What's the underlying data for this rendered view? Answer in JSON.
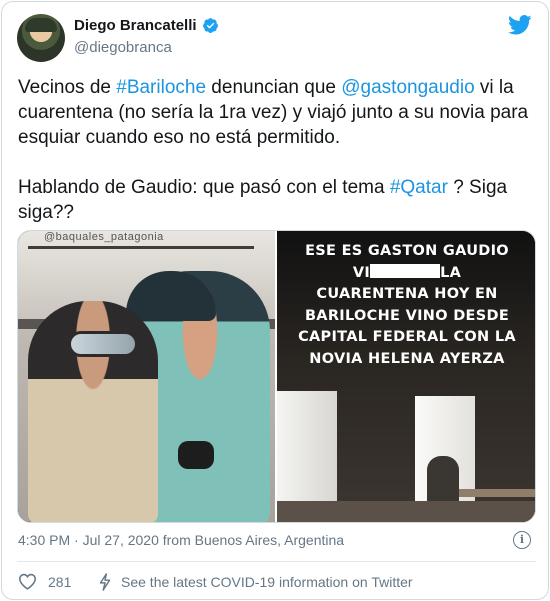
{
  "author": {
    "display_name": "Diego Brancatelli",
    "handle": "@diegobranca",
    "verified": true
  },
  "tweet": {
    "line1_a": "Vecinos de ",
    "hashtag1": "#Bariloche",
    "line1_b": " denuncian que ",
    "mention": "@gastongaudio",
    "line1_c": " vi la cuarentena (no sería la 1ra vez) y viajó junto a su novia para esquiar cuando eso no está permitido.",
    "line2_a": "Hablando de Gaudio: que pasó con el tema ",
    "hashtag2": "#Qatar",
    "line2_b": " ? Siga siga??"
  },
  "media": {
    "left_photo_tag": "@baquales_patagonia",
    "caption_line1": "ESE ES GASTON GAUDIO",
    "caption_line2_a": "VI",
    "caption_line2_b": "LA",
    "caption_rest": "CUARENTENA HOY EN BARILOCHE VINO DESDE CAPITAL FEDERAL CON LA NOVIA HELENA AYERZA"
  },
  "meta": {
    "timestamp": "4:30 PM · Jul 27, 2020 from Buenos Aires, Argentina"
  },
  "actions": {
    "like_count": "281",
    "covid_info": "See the latest COVID-19 information on Twitter"
  },
  "colors": {
    "link": "#1b95e0",
    "twitter_blue": "#1da1f2",
    "secondary_text": "#657786"
  },
  "icons": {
    "avatar": "avatar",
    "verified": "verified-badge-icon",
    "brand": "twitter-bird-icon",
    "info": "info-icon",
    "like": "heart-icon",
    "covid": "lightning-icon"
  }
}
